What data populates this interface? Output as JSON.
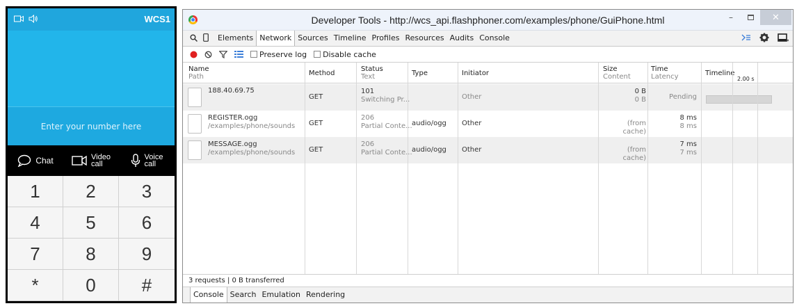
{
  "phone": {
    "status_label": "WCS1",
    "input_placeholder": "Enter your number here",
    "actions": [
      {
        "label": "Chat"
      },
      {
        "label1": "Video",
        "label2": "call"
      },
      {
        "label1": "Voice",
        "label2": "call"
      }
    ],
    "keys": [
      "1",
      "2",
      "3",
      "4",
      "5",
      "6",
      "7",
      "8",
      "9",
      "*",
      "0",
      "#"
    ]
  },
  "devtools": {
    "title": "Developer Tools - http://wcs_api.flashphoner.com/examples/phone/GuiPhone.html",
    "tabs": [
      "Elements",
      "Network",
      "Sources",
      "Timeline",
      "Profiles",
      "Resources",
      "Audits",
      "Console"
    ],
    "active_tab": "Network",
    "toolbar": {
      "preserve_log": "Preserve log",
      "disable_cache": "Disable cache"
    },
    "headers": {
      "name": "Name",
      "path": "Path",
      "method": "Method",
      "status": "Status",
      "text": "Text",
      "type": "Type",
      "initiator": "Initiator",
      "size": "Size",
      "content": "Content",
      "time": "Time",
      "latency": "Latency",
      "timeline": "Timeline",
      "timeline_tick": "2.00 s"
    },
    "rows": [
      {
        "name": "188.40.69.75",
        "path": "",
        "method": "GET",
        "status": "101",
        "status_text": "Switching Pr...",
        "type": "",
        "initiator": "Other",
        "size": "0 B",
        "content": "0 B",
        "time": "Pending",
        "latency": ""
      },
      {
        "name": "REGISTER.ogg",
        "path": "/examples/phone/sounds",
        "method": "GET",
        "status": "206",
        "status_text": "Partial Conte...",
        "type": "audio/ogg",
        "initiator": "Other",
        "size": "(from cache)",
        "content": "",
        "time": "8 ms",
        "latency": "8 ms"
      },
      {
        "name": "MESSAGE.ogg",
        "path": "/examples/phone/sounds",
        "method": "GET",
        "status": "206",
        "status_text": "Partial Conte...",
        "type": "audio/ogg",
        "initiator": "Other",
        "size": "(from cache)",
        "content": "",
        "time": "7 ms",
        "latency": "7 ms"
      }
    ],
    "summary": "3 requests | 0 B transferred",
    "drawer_tabs": [
      "Console",
      "Search",
      "Emulation",
      "Rendering"
    ],
    "active_drawer_tab": "Console"
  },
  "colors": {
    "phone_blue": "#22b5ea",
    "record_red": "#e02020",
    "accent_blue": "#3c7fd9"
  }
}
